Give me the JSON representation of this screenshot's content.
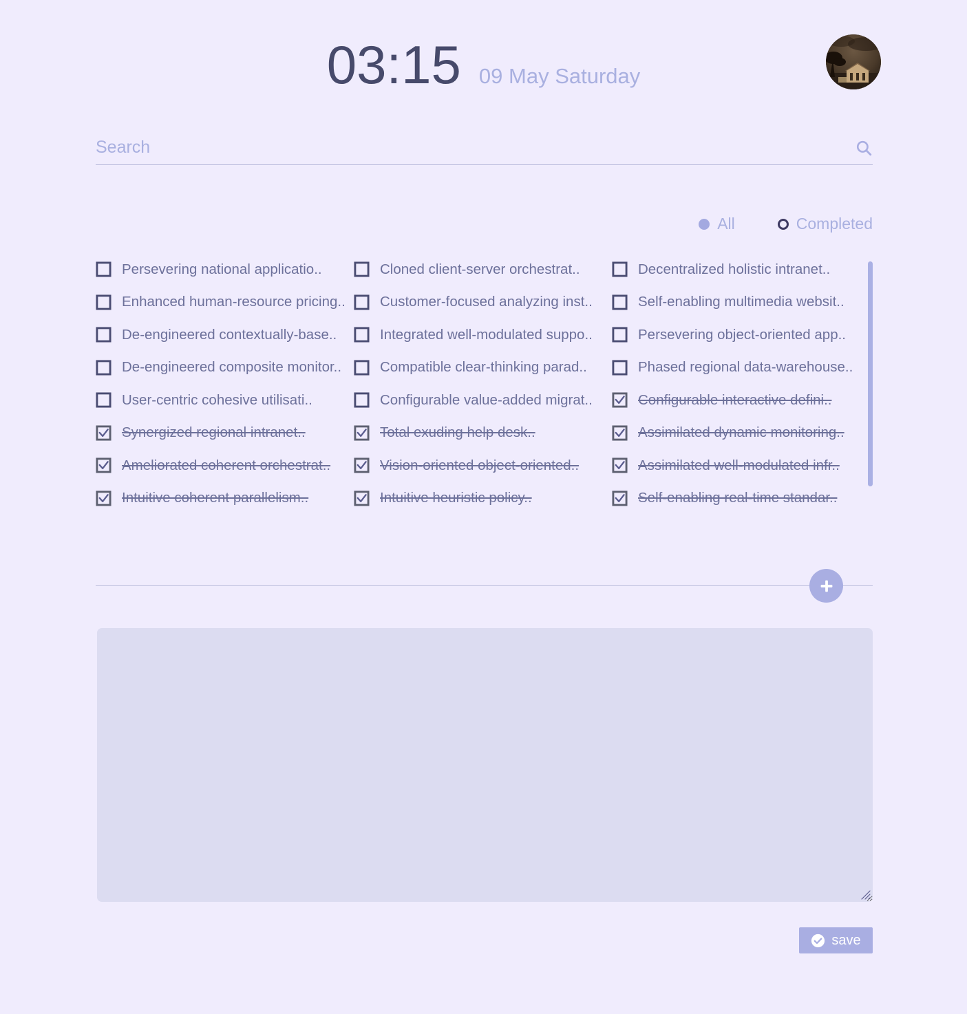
{
  "header": {
    "time": "03:15",
    "date": "09 May Saturday",
    "avatar_alt": "user-avatar-photo"
  },
  "search": {
    "placeholder": "Search",
    "value": "",
    "icon": "search-icon"
  },
  "filters": [
    {
      "label": "All",
      "state": "filled"
    },
    {
      "label": "Completed",
      "state": "ring"
    }
  ],
  "todo_columns": [
    [
      {
        "text": "Persevering national applicatio..",
        "done": false
      },
      {
        "text": "Enhanced human-resource pricing..",
        "done": false
      },
      {
        "text": "De-engineered contextually-base..",
        "done": false
      },
      {
        "text": "De-engineered composite monitor..",
        "done": false
      },
      {
        "text": "User-centric cohesive utilisati..",
        "done": false
      },
      {
        "text": "Synergized regional intranet..",
        "done": true
      },
      {
        "text": "Ameliorated coherent orchestrat..",
        "done": true
      },
      {
        "text": "Intuitive coherent parallelism..",
        "done": true
      }
    ],
    [
      {
        "text": "Cloned client-server orchestrat..",
        "done": false
      },
      {
        "text": "Customer-focused analyzing inst..",
        "done": false
      },
      {
        "text": "Integrated well-modulated suppo..",
        "done": false
      },
      {
        "text": "Compatible clear-thinking parad..",
        "done": false
      },
      {
        "text": "Configurable value-added migrat..",
        "done": false
      },
      {
        "text": "Total exuding help desk..",
        "done": true
      },
      {
        "text": "Vision-oriented object-oriented..",
        "done": true
      },
      {
        "text": "Intuitive heuristic policy..",
        "done": true
      }
    ],
    [
      {
        "text": "Decentralized holistic intranet..",
        "done": false
      },
      {
        "text": "Self-enabling multimedia websit..",
        "done": false
      },
      {
        "text": "Persevering object-oriented app..",
        "done": false
      },
      {
        "text": "Phased regional data-warehouse..",
        "done": false
      },
      {
        "text": "Configurable interactive defini..",
        "done": true
      },
      {
        "text": "Assimilated dynamic monitoring..",
        "done": true
      },
      {
        "text": "Assimilated well-modulated infr..",
        "done": true
      },
      {
        "text": "Self-enabling real-time standar..",
        "done": true
      }
    ]
  ],
  "add_button": {
    "icon": "plus-icon",
    "label": ""
  },
  "note": {
    "value": "",
    "placeholder": ""
  },
  "save": {
    "label": "save",
    "icon": "check-circle-icon"
  },
  "colors": {
    "background": "#f0ecfd",
    "accent": "#a9aee2",
    "text_dark": "#474a6b",
    "text_muted": "#6d719b",
    "text_light": "#a9b0e0",
    "note_bg": "#dcdcf1",
    "checkbox_border": "#4a4c72",
    "checkbox_done_border": "#5d6070"
  }
}
